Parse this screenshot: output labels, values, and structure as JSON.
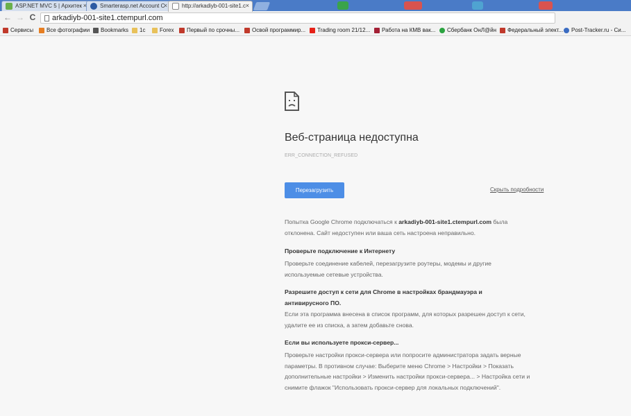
{
  "tabs": [
    {
      "title": "ASP.NET MVC 5 | Архитек",
      "favicon_color": "#6ab04c",
      "active": false
    },
    {
      "title": "Smarterasp.net Account C",
      "favicon_color": "#2d5aa3",
      "active": false
    },
    {
      "title": "http://arkadiyb-001-site1.c",
      "favicon_color": "#ffffff",
      "active": true
    }
  ],
  "tab_close_glyph": "×",
  "toolbar": {
    "back_glyph": "←",
    "forward_glyph": "→",
    "reload_glyph": "C",
    "url": "arkadiyb-001-site1.ctempurl.com"
  },
  "bookmarks": [
    {
      "label": "Сервисы",
      "icon": "apps-icon",
      "color": "#c0392b"
    },
    {
      "label": "Все фотографии",
      "icon": "photos-icon",
      "color": "#e67e22"
    },
    {
      "label": "Bookmarks",
      "icon": "star-icon",
      "color": "#555555"
    },
    {
      "label": "1с",
      "icon": "folder-icon",
      "color": "#e8c15a"
    },
    {
      "label": "Forex",
      "icon": "folder-icon",
      "color": "#e8c15a"
    },
    {
      "label": "Первый по срочны...",
      "icon": "l-icon",
      "color": "#c0392b"
    },
    {
      "label": "Освой программир...",
      "icon": "paw-icon",
      "color": "#c0392b"
    },
    {
      "label": "Trading room 21/12...",
      "icon": "youtube-icon",
      "color": "#e62117"
    },
    {
      "label": "Работа на КМВ вак...",
      "icon": "k-icon",
      "color": "#a32035"
    },
    {
      "label": "Сбербанк ОнЛ@йн",
      "icon": "sber-icon",
      "color": "#2ba340"
    },
    {
      "label": "Федеральный элект...",
      "icon": "gov-icon",
      "color": "#c0392b"
    },
    {
      "label": "Post-Tracker.ru - Си...",
      "icon": "globe-icon",
      "color": "#3b6cc2"
    }
  ],
  "error": {
    "title": "Веб-страница недоступна",
    "code": "ERR_CONNECTION_REFUSED",
    "reload_label": "Перезагрузить",
    "details_label": "Скрыть подробности",
    "intro_pre": "Попытка Google Chrome подключаться к ",
    "intro_host": "arkadiyb-001-site1.ctempurl.com",
    "intro_post": " была отклонена. Сайт недоступен или ваша сеть настроена неправильно.",
    "sections": [
      {
        "heading": "Проверьте подключение к Интернету",
        "text": "Проверьте соединение кабелей, перезагрузите роутеры, модемы и другие используемые сетевые устройства."
      },
      {
        "heading": "Разрешите доступ к сети для Chrome в настройках брандмауэра и антивирусного ПО.",
        "text": "Если эта программа внесена в список программ, для которых разрешен доступ к сети, удалите ее из списка, а затем добавьте снова."
      },
      {
        "heading": "Если вы используете прокси-сервер...",
        "text": "Проверьте настройки прокси-сервера или попросите администратора задать верные параметры. В противном случае: Выберите меню Chrome > Настройки > Показать дополнительные настройки > Изменить настройки прокси-сервера... > Настройка сети и снимите флажок \"Использовать прокси-сервер для локальных подключений\"."
      }
    ]
  }
}
